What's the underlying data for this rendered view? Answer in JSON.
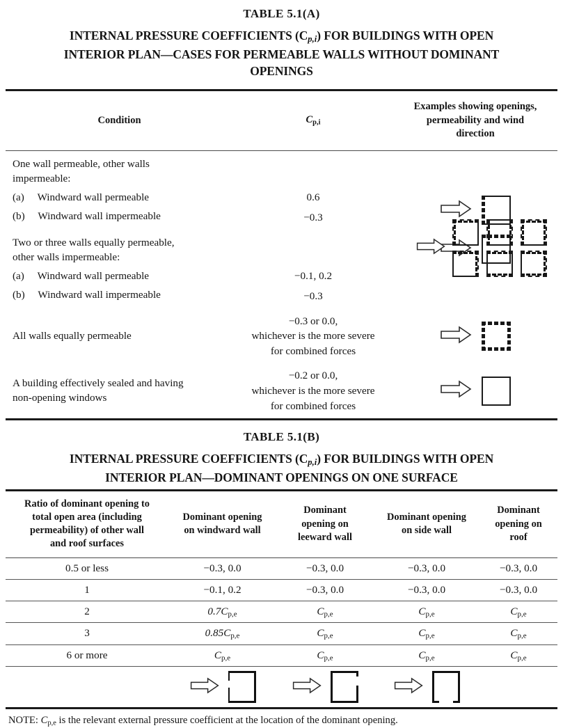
{
  "tableA": {
    "number": "TABLE   5.1(A)",
    "title_line1": "INTERNAL PRESSURE COEFFICIENTS (C",
    "title_sub": "p,i",
    "title_line2": ") FOR BUILDINGS WITH OPEN",
    "title_line3": "INTERIOR PLAN—CASES FOR PERMEABLE WALLS WITHOUT DOMINANT",
    "title_line4": "OPENINGS",
    "headers": {
      "condition": "Condition",
      "cpi_main": "C",
      "cpi_sub": "p,i",
      "examples_l1": "Examples showing openings,",
      "examples_l2": "permeability and wind",
      "examples_l3": "direction"
    },
    "rows": [
      {
        "lead": "One wall permeable, other walls",
        "lead2": "impermeable:",
        "item_a": "(a)     Windward wall permeable",
        "item_b": "(b)     Windward wall impermeable",
        "value_a": "0.6",
        "value_b": "−0.3"
      },
      {
        "lead": "Two or three walls equally permeable,",
        "lead2": "other walls impermeable:",
        "item_a": "(a)     Windward wall permeable",
        "item_b": "(b)     Windward wall impermeable",
        "value_a": "−0.1, 0.2",
        "value_b": "−0.3"
      },
      {
        "condition": "All walls equally permeable",
        "value_l1": "−0.3 or 0.0,",
        "value_l2": "whichever is the more severe",
        "value_l3": "for combined forces"
      },
      {
        "condition_l1": "A building effectively sealed and having",
        "condition_l2": "non-opening windows",
        "value_l1": "−0.2 or 0.0,",
        "value_l2": "whichever is the more severe",
        "value_l3": "for combined forces"
      }
    ]
  },
  "tableB": {
    "number": "TABLE   5.1(B)",
    "title_line1": "INTERNAL PRESSURE COEFFICIENTS (C",
    "title_sub": "p,i",
    "title_line2": ") FOR BUILDINGS WITH OPEN",
    "title_line3": "INTERIOR PLAN—DOMINANT OPENINGS ON ONE SURFACE",
    "headers": {
      "ratio_l1": "Ratio of dominant opening to",
      "ratio_l2": "total open area (including",
      "ratio_l3": "permeability) of other wall",
      "ratio_l4": "and roof surfaces",
      "windward_l1": "Dominant opening",
      "windward_l2": "on windward wall",
      "leeward_l1": "Dominant",
      "leeward_l2": "opening on",
      "leeward_l3": "leeward wall",
      "side_l1": "Dominant opening",
      "side_l2": "on side wall",
      "roof_l1": "Dominant",
      "roof_l2": "opening on",
      "roof_l3": "roof"
    },
    "rows": [
      {
        "ratio": "0.5 or less",
        "windward": "−0.3, 0.0",
        "leeward": "−0.3, 0.0",
        "side": "−0.3, 0.0",
        "roof": "−0.3, 0.0"
      },
      {
        "ratio": "1",
        "windward": "−0.1, 0.2",
        "leeward": "−0.3, 0.0",
        "side": "−0.3, 0.0",
        "roof": "−0.3, 0.0"
      },
      {
        "ratio": "2",
        "windward_pre": "0.7C",
        "windward_sub": "p,e",
        "leeward_pre": "C",
        "leeward_sub": "p,e",
        "side_pre": "C",
        "side_sub": "p,e",
        "roof_pre": "C",
        "roof_sub": "p,e"
      },
      {
        "ratio": "3",
        "windward_pre": "0.85C",
        "windward_sub": "p,e",
        "leeward_pre": "C",
        "leeward_sub": "p,e",
        "side_pre": "C",
        "side_sub": "p,e",
        "roof_pre": "C",
        "roof_sub": "p,e"
      },
      {
        "ratio": "6 or more",
        "windward_pre": "C",
        "windward_sub": "p,e",
        "leeward_pre": "C",
        "leeward_sub": "p,e",
        "side_pre": "C",
        "side_sub": "p,e",
        "roof_pre": "C",
        "roof_sub": "p,e"
      }
    ],
    "note_pre": "NOTE: ",
    "note_sym": "C",
    "note_sub": "p,e",
    "note_rest": " is the relevant external pressure coefficient at the location of the dominant opening."
  },
  "icons": {
    "wind_arrow": "wind-direction-arrow",
    "building_plan": "building-plan-square"
  }
}
